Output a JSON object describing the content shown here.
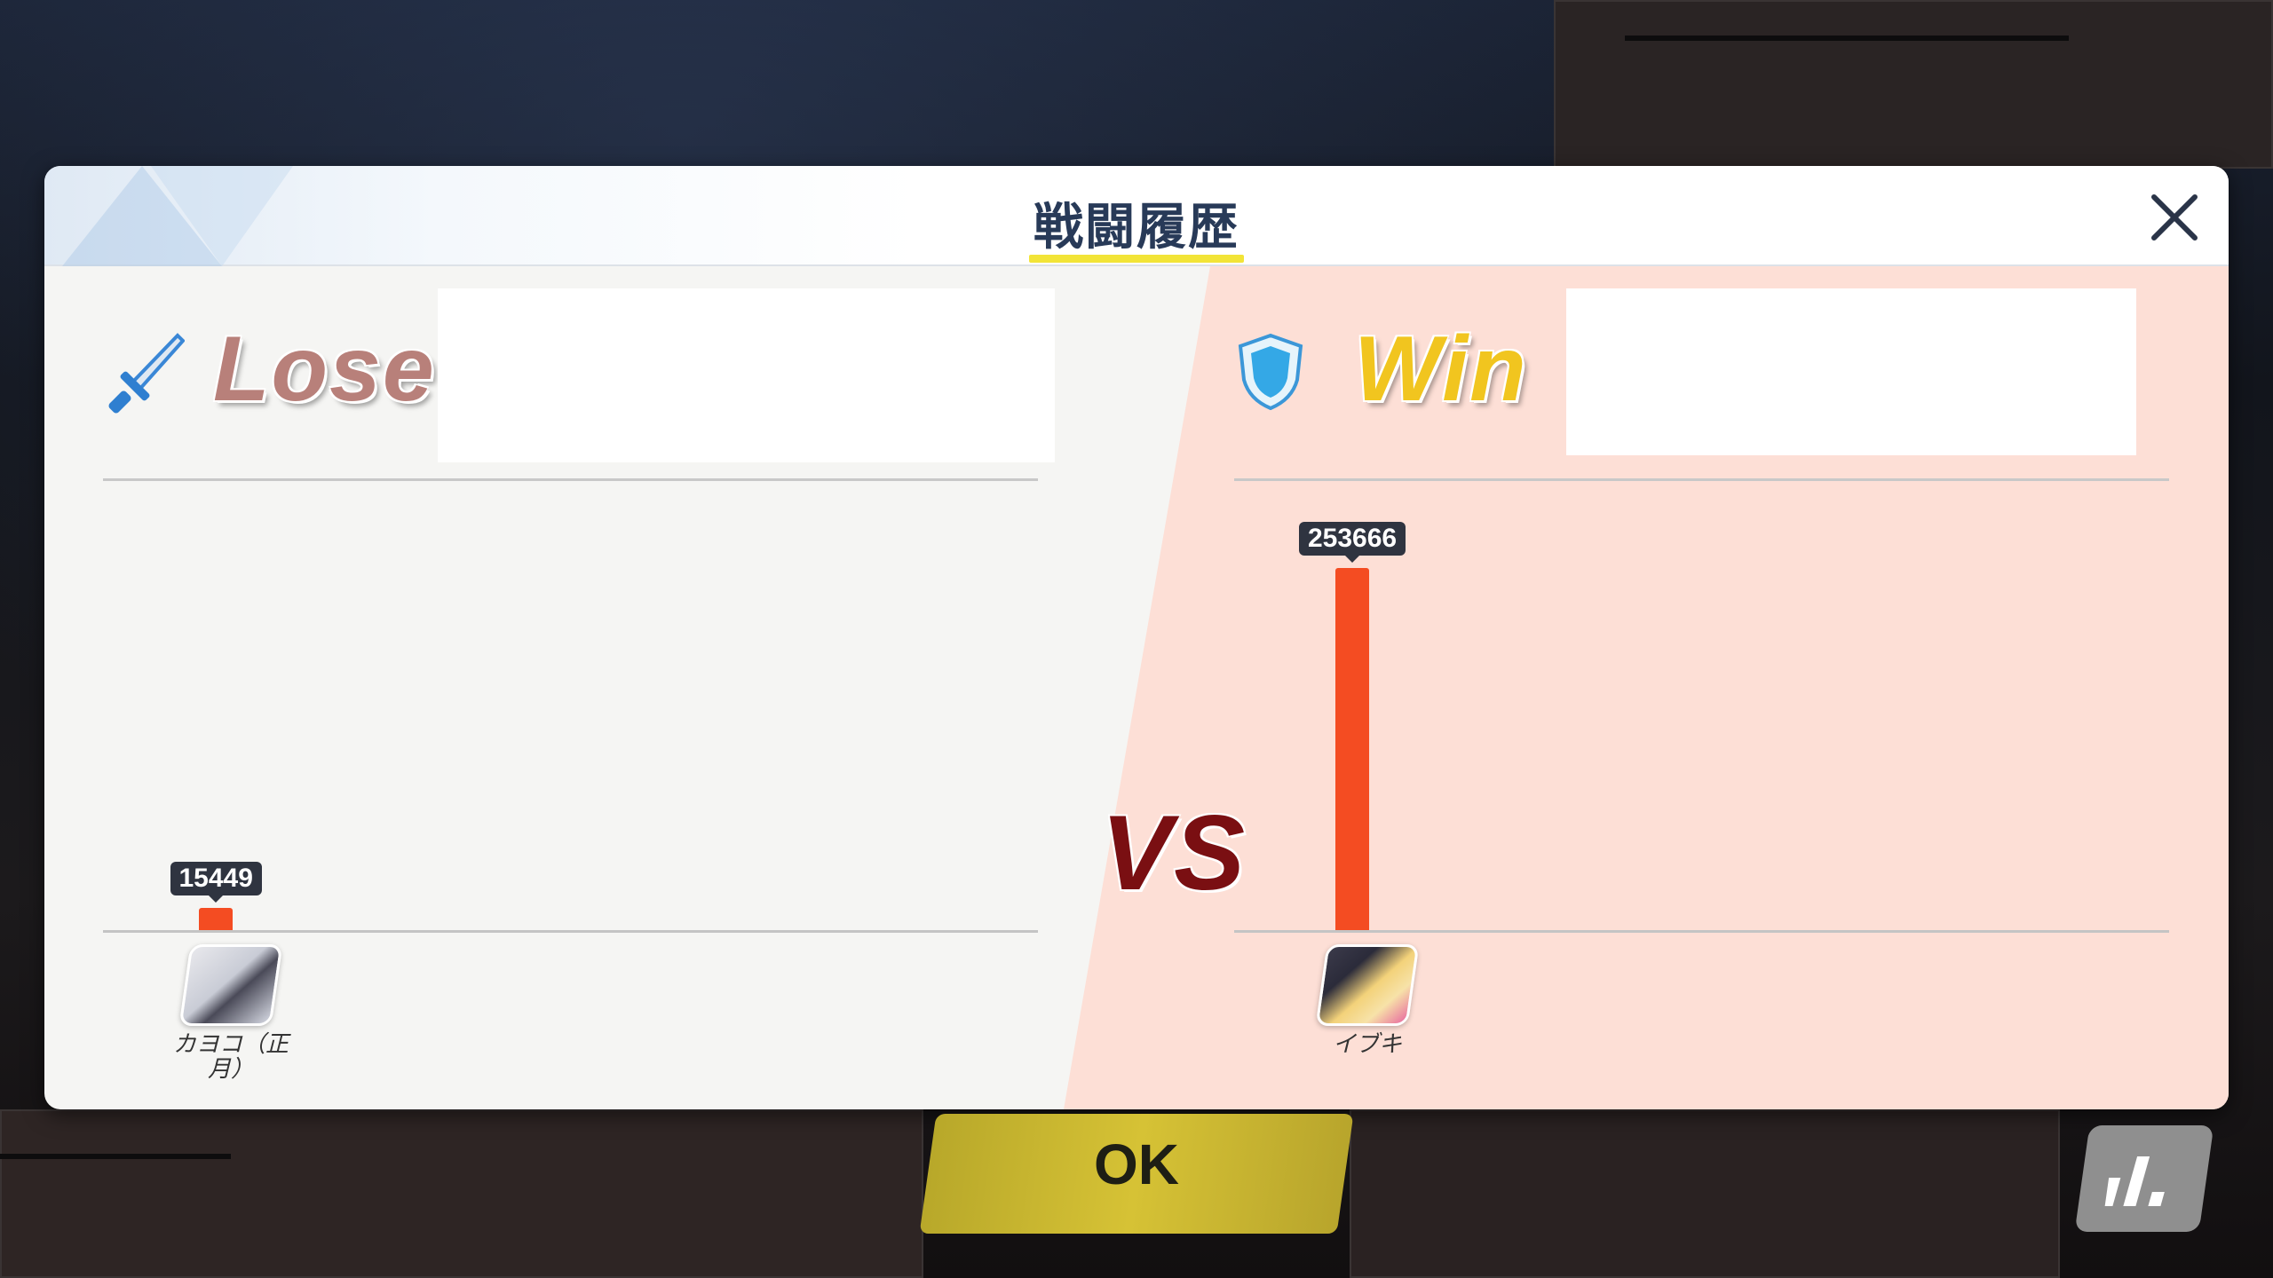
{
  "dialog": {
    "title": "戦闘履歴",
    "close_icon": "close-icon"
  },
  "lose_side": {
    "result": "Lose",
    "icon": "sword-icon",
    "character": {
      "name": "カヨコ（正月）",
      "name_line1": "カヨコ（正",
      "name_line2": "月）",
      "value": 15449
    },
    "value_label": "15449"
  },
  "win_side": {
    "result": "Win",
    "icon": "shield-icon",
    "character": {
      "name": "イブキ",
      "value": 253666
    },
    "value_label": "253666"
  },
  "vs_label": "VS",
  "footer": {
    "ok_label": "OK",
    "stats_icon": "bar-chart-icon"
  },
  "chart_data": [
    {
      "type": "bar",
      "categories": [
        "カヨコ（正月）"
      ],
      "values": [
        15449
      ],
      "ylim": [
        0,
        253666
      ]
    },
    {
      "type": "bar",
      "categories": [
        "イブキ"
      ],
      "values": [
        253666
      ],
      "ylim": [
        0,
        253666
      ]
    }
  ],
  "colors": {
    "bar": "#f44c22",
    "win_bg": "#fddfd6",
    "lose_bg": "#f5f5f3",
    "accent_yellow": "#f2e437",
    "vs": "#7a0f12"
  }
}
